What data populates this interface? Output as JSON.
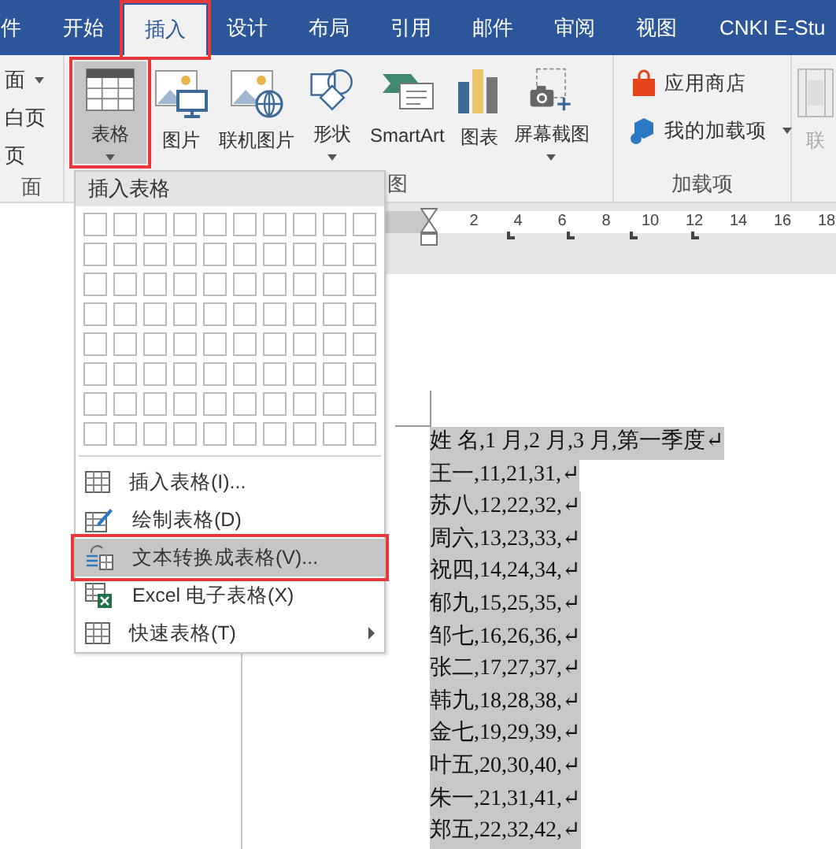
{
  "tabs": [
    {
      "label": "件",
      "selected": false,
      "annotated": false
    },
    {
      "label": "开始",
      "selected": false,
      "annotated": false
    },
    {
      "label": "插入",
      "selected": true,
      "annotated": true
    },
    {
      "label": "设计",
      "selected": false,
      "annotated": false
    },
    {
      "label": "布局",
      "selected": false,
      "annotated": false
    },
    {
      "label": "引用",
      "selected": false,
      "annotated": false
    },
    {
      "label": "邮件",
      "selected": false,
      "annotated": false
    },
    {
      "label": "审阅",
      "selected": false,
      "annotated": false
    },
    {
      "label": "视图",
      "selected": false,
      "annotated": false
    },
    {
      "label": "CNKI E-Stu",
      "selected": false,
      "annotated": false
    }
  ],
  "ribbon": {
    "groups": [
      {
        "kind": "small",
        "label": "面",
        "buttons": [
          {
            "label": "面",
            "dropdown": true
          },
          {
            "label": "白页",
            "dropdown": false
          },
          {
            "label": "页",
            "dropdown": false
          }
        ]
      },
      {
        "kind": "large",
        "label": "图",
        "buttons": [
          {
            "label": "表格",
            "dropdown": true,
            "pressed": true,
            "annotated": true,
            "disabled": false
          },
          {
            "label": "图片",
            "dropdown": false,
            "pressed": false,
            "annotated": false,
            "disabled": false
          },
          {
            "label": "联机图片",
            "dropdown": false,
            "pressed": false,
            "annotated": false,
            "disabled": false
          },
          {
            "label": "形状",
            "dropdown": true,
            "pressed": false,
            "annotated": false,
            "disabled": false
          },
          {
            "label": "SmartArt",
            "dropdown": false,
            "pressed": false,
            "annotated": false,
            "disabled": false
          },
          {
            "label": "图表",
            "dropdown": false,
            "pressed": false,
            "annotated": false,
            "disabled": false
          },
          {
            "label": "屏幕截图",
            "dropdown": true,
            "pressed": false,
            "annotated": false,
            "disabled": false
          }
        ]
      },
      {
        "kind": "small",
        "label": "加载项",
        "buttons": [
          {
            "label": "应用商店",
            "dropdown": false
          },
          {
            "label": "我的加载项",
            "dropdown": true
          }
        ]
      },
      {
        "kind": "large",
        "buttons": [
          {
            "label": "联",
            "disabled": true
          }
        ]
      }
    ]
  },
  "ruler": {
    "labels": [
      "2",
      "4",
      "6",
      "8",
      "10",
      "12",
      "14",
      "16",
      "18"
    ]
  },
  "table_menu": {
    "title": "插入表格",
    "items": [
      {
        "label": "插入表格(I)...",
        "highlighted": false,
        "submenu": false,
        "annotated": false
      },
      {
        "label": "绘制表格(D)",
        "highlighted": false,
        "submenu": false,
        "annotated": false
      },
      {
        "label": "文本转换成表格(V)...",
        "highlighted": true,
        "submenu": false,
        "annotated": true
      },
      {
        "label": "Excel 电子表格(X)",
        "highlighted": false,
        "submenu": false,
        "annotated": false
      },
      {
        "label": "快速表格(T)",
        "highlighted": false,
        "submenu": true,
        "annotated": false
      }
    ]
  },
  "document": {
    "lines": [
      {
        "text": "姓 名,1 月,2 月,3 月,第一季度↵",
        "selected": true
      },
      {
        "text": "王一,11,21,31,↵",
        "selected": true
      },
      {
        "text": "苏八,12,22,32,↵",
        "selected": true
      },
      {
        "text": "周六,13,23,33,↵",
        "selected": true
      },
      {
        "text": "祝四,14,24,34,↵",
        "selected": true
      },
      {
        "text": "郁九,15,25,35,↵",
        "selected": true
      },
      {
        "text": "邹七,16,26,36,↵",
        "selected": true
      },
      {
        "text": "张二,17,27,37,↵",
        "selected": true
      },
      {
        "text": "韩九,18,28,38,↵",
        "selected": true
      },
      {
        "text": "金七,19,29,39,↵",
        "selected": true
      },
      {
        "text": "叶五,20,30,40,↵",
        "selected": true
      },
      {
        "text": "朱一,21,31,41,↵",
        "selected": true
      },
      {
        "text": "郑五,22,32,42,↵",
        "selected": true
      }
    ]
  }
}
